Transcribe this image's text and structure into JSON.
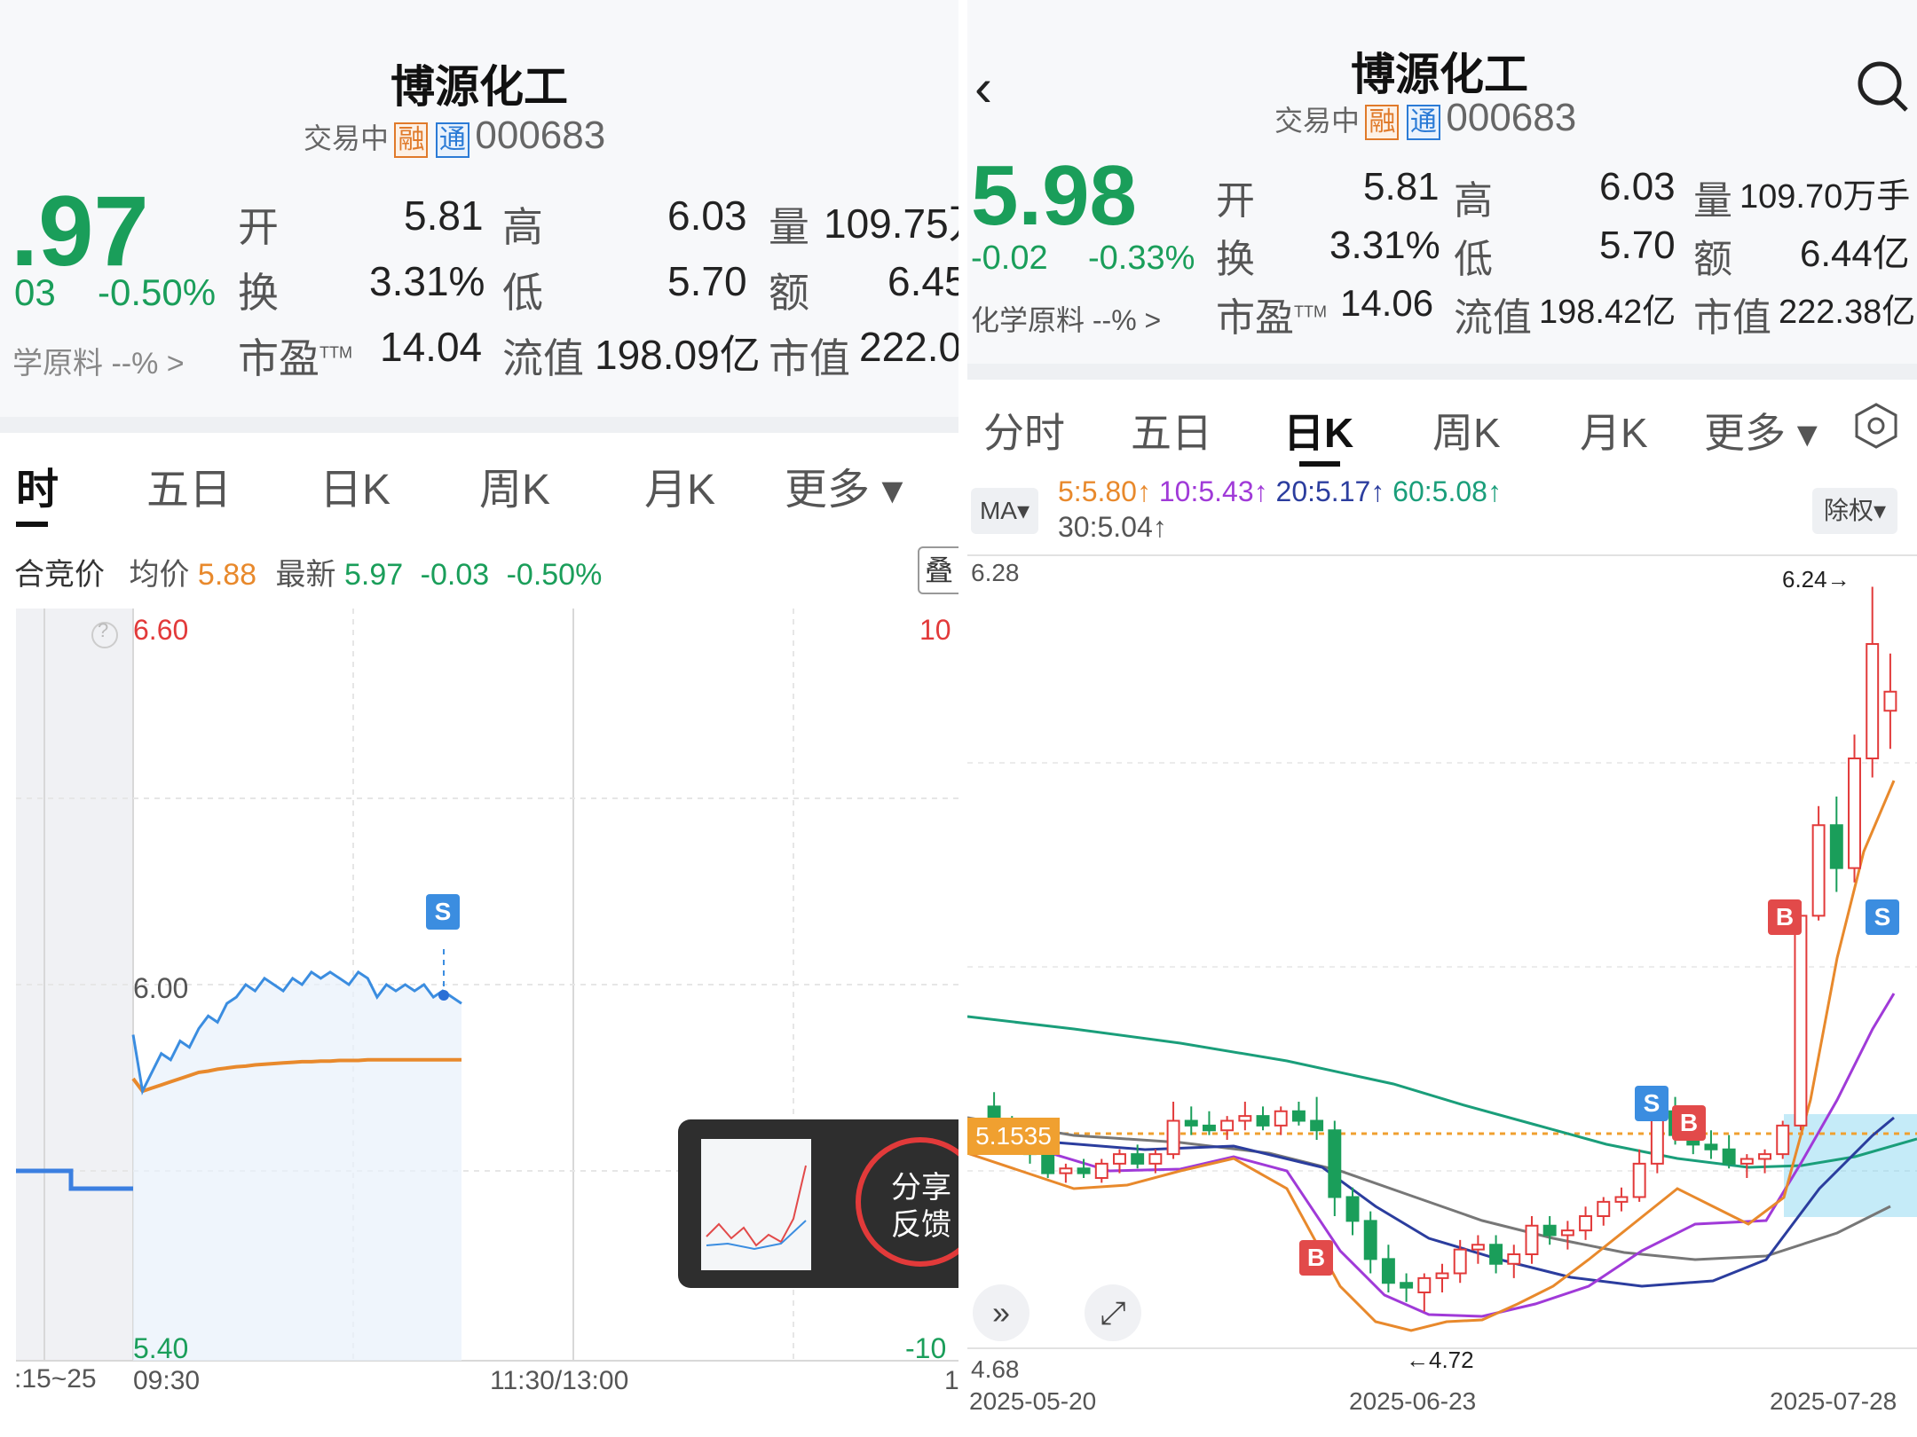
{
  "left": {
    "title": "博源化工",
    "status": "交易中",
    "tag_rong": "融",
    "tag_tong": "通",
    "code": "000683",
    "price": ".97",
    "change": "03",
    "change_pct": "-0.50%",
    "sector": "学原料 --% >",
    "stats": {
      "open_label": "开",
      "open": "5.81",
      "high_label": "高",
      "high": "6.03",
      "vol_label": "量",
      "vol": "109.75万",
      "turnover_label": "换",
      "turnover": "3.31%",
      "low_label": "低",
      "low": "5.70",
      "amount_label": "额",
      "amount": "6.45",
      "pe_label": "市盈",
      "pe_sup": "TTM",
      "pe": "14.04",
      "float_label": "流值",
      "float": "198.09亿",
      "mcap_label": "市值",
      "mcap": "222.0"
    },
    "tabs": [
      "时",
      "五日",
      "日K",
      "周K",
      "月K",
      "更多 ▾"
    ],
    "info": {
      "prefix": "合竞价",
      "avg_label": "均价",
      "avg": "5.88",
      "latest_label": "最新",
      "latest": "5.97",
      "chg": "-0.03",
      "chg_pct": "-0.50%",
      "overlay_btn": "叠"
    },
    "chart": {
      "y_top": "6.60",
      "y_mid": "6.00",
      "y_bot": "5.40",
      "pct_top": "10",
      "pct_bot": "-10",
      "x_left": ":15~25",
      "x_open": "09:30",
      "x_mid": "11:30/13:00",
      "x_right": "1",
      "help": "?",
      "s_badge": "S"
    },
    "share_popup": {
      "line1": "分享",
      "line2": "反馈"
    },
    "chart_data": {
      "type": "line",
      "series": [
        {
          "values": [
            5.92,
            5.83,
            5.86,
            5.89,
            5.88,
            5.91,
            5.9,
            5.93,
            5.95,
            5.94,
            5.97,
            5.98,
            6.0,
            5.99,
            6.01,
            6.0,
            5.99,
            6.01,
            6.0,
            6.02,
            6.01,
            6.02,
            6.01,
            6.0,
            6.02,
            6.01,
            5.98,
            6.0,
            5.99,
            6.0,
            5.99,
            6.0,
            5.98,
            5.99,
            5.98,
            5.97
          ]
        },
        {
          "values": [
            5.85,
            5.83,
            5.835,
            5.84,
            5.845,
            5.85,
            5.855,
            5.86,
            5.862,
            5.865,
            5.867,
            5.869,
            5.87,
            5.872,
            5.873,
            5.874,
            5.875,
            5.876,
            5.877,
            5.877,
            5.878,
            5.878,
            5.879,
            5.879,
            5.879,
            5.88,
            5.88,
            5.88,
            5.88,
            5.88,
            5.88,
            5.88,
            5.88,
            5.88,
            5.88,
            5.88
          ]
        }
      ],
      "ylim": [
        5.4,
        6.6
      ]
    }
  },
  "right": {
    "title": "博源化工",
    "status": "交易中",
    "tag_rong": "融",
    "tag_tong": "通",
    "code": "000683",
    "price": "5.98",
    "change": "-0.02",
    "change_pct": "-0.33%",
    "sector": "化学原料 --% >",
    "stats": {
      "open_label": "开",
      "open": "5.81",
      "high_label": "高",
      "high": "6.03",
      "vol_label": "量",
      "vol": "109.70万手",
      "turnover_label": "换",
      "turnover": "3.31%",
      "low_label": "低",
      "low": "5.70",
      "amount_label": "额",
      "amount": "6.44亿",
      "pe_label": "市盈",
      "pe_sup": "TTM",
      "pe": "14.06",
      "float_label": "流值",
      "float": "198.42亿",
      "mcap_label": "市值",
      "mcap": "222.38亿"
    },
    "tabs": [
      "分时",
      "五日",
      "日K",
      "周K",
      "月K",
      "更多 ▾"
    ],
    "ma": {
      "label": "MA▾",
      "ma5": "5:5.80↑",
      "ma10": "10:5.43↑",
      "ma20": "20:5.17↑",
      "ma60": "60:5.08↑",
      "ma30": "30:5.04↑",
      "exright": "除权▾"
    },
    "chart": {
      "y_top": "6.28",
      "y_bot": "4.68",
      "price_line": "5.1535",
      "high_ann": "6.24→",
      "low_ann": "←4.72",
      "x_start": "2025-05-20",
      "x_mid": "2025-06-23",
      "x_end": "2025-07-28",
      "b": "B",
      "s": "S"
    },
    "chart_data": {
      "type": "candlestick",
      "ylim": [
        4.68,
        6.28
      ],
      "candles": [
        [
          5.15,
          5.18,
          5.1,
          5.12
        ],
        [
          5.12,
          5.13,
          5.05,
          5.07
        ],
        [
          5.07,
          5.09,
          5.03,
          5.05
        ],
        [
          5.05,
          5.06,
          5.0,
          5.01
        ],
        [
          5.01,
          5.03,
          4.99,
          5.02
        ],
        [
          5.02,
          5.04,
          5.0,
          5.01
        ],
        [
          5.0,
          5.04,
          4.99,
          5.03
        ],
        [
          5.03,
          5.06,
          5.01,
          5.05
        ],
        [
          5.05,
          5.07,
          5.02,
          5.03
        ],
        [
          5.03,
          5.06,
          5.01,
          5.05
        ],
        [
          5.05,
          5.16,
          5.04,
          5.12
        ],
        [
          5.12,
          5.15,
          5.09,
          5.11
        ],
        [
          5.11,
          5.14,
          5.09,
          5.1
        ],
        [
          5.1,
          5.13,
          5.08,
          5.12
        ],
        [
          5.12,
          5.16,
          5.1,
          5.13
        ],
        [
          5.13,
          5.15,
          5.1,
          5.11
        ],
        [
          5.11,
          5.15,
          5.09,
          5.14
        ],
        [
          5.14,
          5.16,
          5.11,
          5.12
        ],
        [
          5.12,
          5.17,
          5.08,
          5.1
        ],
        [
          5.1,
          5.12,
          4.92,
          4.96
        ],
        [
          4.96,
          4.98,
          4.88,
          4.91
        ],
        [
          4.91,
          4.93,
          4.8,
          4.83
        ],
        [
          4.83,
          4.86,
          4.76,
          4.78
        ],
        [
          4.78,
          4.8,
          4.74,
          4.77
        ],
        [
          4.76,
          4.8,
          4.72,
          4.79
        ],
        [
          4.79,
          4.82,
          4.76,
          4.8
        ],
        [
          4.8,
          4.87,
          4.78,
          4.85
        ],
        [
          4.85,
          4.88,
          4.82,
          4.86
        ],
        [
          4.86,
          4.88,
          4.8,
          4.82
        ],
        [
          4.82,
          4.86,
          4.79,
          4.84
        ],
        [
          4.84,
          4.92,
          4.82,
          4.9
        ],
        [
          4.9,
          4.92,
          4.86,
          4.88
        ],
        [
          4.88,
          4.91,
          4.85,
          4.89
        ],
        [
          4.89,
          4.94,
          4.87,
          4.92
        ],
        [
          4.92,
          4.96,
          4.9,
          4.95
        ],
        [
          4.95,
          4.98,
          4.93,
          4.96
        ],
        [
          4.96,
          5.06,
          4.95,
          5.03
        ],
        [
          5.03,
          5.16,
          5.01,
          5.14
        ],
        [
          5.14,
          5.17,
          5.07,
          5.09
        ],
        [
          5.09,
          5.12,
          5.05,
          5.07
        ],
        [
          5.07,
          5.1,
          5.04,
          5.06
        ],
        [
          5.06,
          5.09,
          5.02,
          5.03
        ],
        [
          5.03,
          5.05,
          5.0,
          5.04
        ],
        [
          5.04,
          5.06,
          5.01,
          5.05
        ],
        [
          5.05,
          5.12,
          5.04,
          5.11
        ],
        [
          5.11,
          5.58,
          5.1,
          5.55
        ],
        [
          5.55,
          5.78,
          5.54,
          5.74
        ],
        [
          5.74,
          5.8,
          5.6,
          5.65
        ],
        [
          5.65,
          5.93,
          5.62,
          5.88
        ],
        [
          5.88,
          6.24,
          5.84,
          6.12
        ],
        [
          5.98,
          6.1,
          5.9,
          6.02
        ]
      ]
    }
  }
}
